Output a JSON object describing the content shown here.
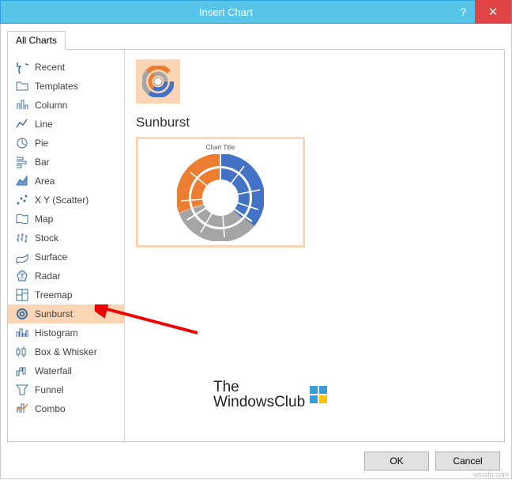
{
  "window": {
    "title": "Insert Chart",
    "help": "?",
    "close": "✕"
  },
  "tab": {
    "all": "All Charts"
  },
  "sidebar": {
    "items": [
      {
        "label": "Recent",
        "icon": "undo"
      },
      {
        "label": "Templates",
        "icon": "folder"
      },
      {
        "label": "Column",
        "icon": "column"
      },
      {
        "label": "Line",
        "icon": "line"
      },
      {
        "label": "Pie",
        "icon": "pie"
      },
      {
        "label": "Bar",
        "icon": "bar"
      },
      {
        "label": "Area",
        "icon": "area"
      },
      {
        "label": "X Y (Scatter)",
        "icon": "scatter"
      },
      {
        "label": "Map",
        "icon": "map"
      },
      {
        "label": "Stock",
        "icon": "stock"
      },
      {
        "label": "Surface",
        "icon": "surface"
      },
      {
        "label": "Radar",
        "icon": "radar"
      },
      {
        "label": "Treemap",
        "icon": "treemap"
      },
      {
        "label": "Sunburst",
        "icon": "sunburst",
        "selected": true
      },
      {
        "label": "Histogram",
        "icon": "histogram"
      },
      {
        "label": "Box & Whisker",
        "icon": "box"
      },
      {
        "label": "Waterfall",
        "icon": "waterfall"
      },
      {
        "label": "Funnel",
        "icon": "funnel"
      },
      {
        "label": "Combo",
        "icon": "combo"
      }
    ]
  },
  "main": {
    "chart_name": "Sunburst",
    "preview_title": "Chart Title"
  },
  "buttons": {
    "ok": "OK",
    "cancel": "Cancel"
  },
  "watermark": {
    "line1": "The",
    "line2": "WindowsClub"
  },
  "footer": "wsxdn.com",
  "colors": {
    "accent": "#56c5e8",
    "select": "#fcd5b4",
    "blue": "#4472c4",
    "orange": "#ed7d31",
    "gray": "#a5a5a5"
  }
}
